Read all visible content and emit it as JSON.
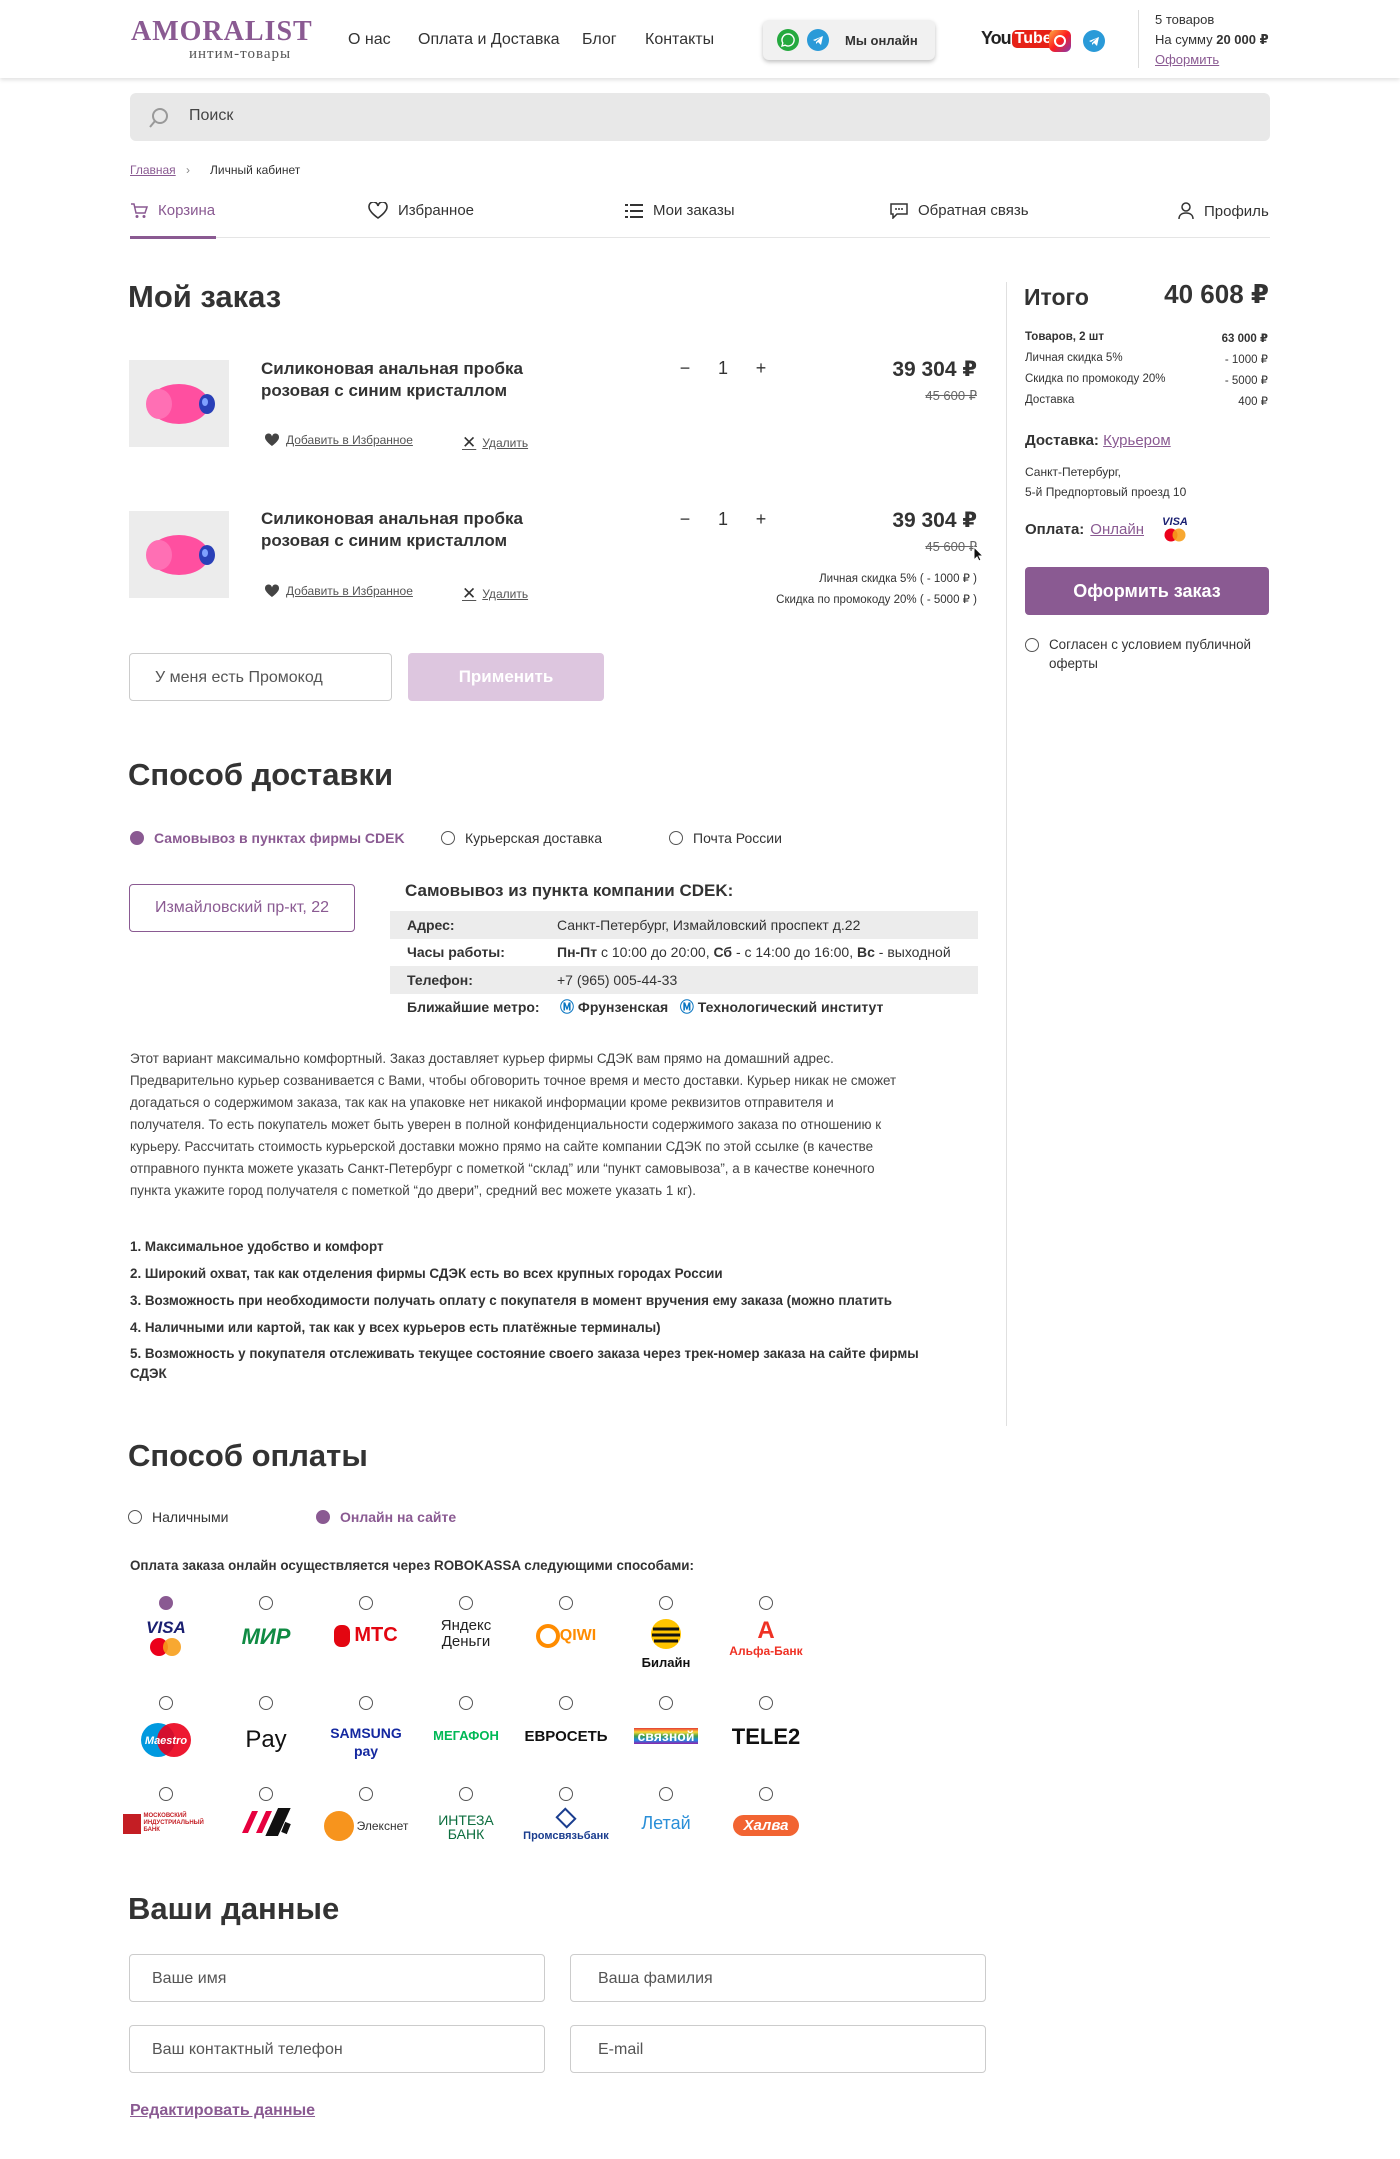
{
  "header": {
    "logo_name": "AMORALIST",
    "logo_sub": "интим-товары",
    "nav": [
      "О нас",
      "Оплата и Доставка",
      "Блог",
      "Контакты"
    ],
    "online_label": "Мы онлайн",
    "cart_count": "5 товаров",
    "cart_sum_label": "На сумму",
    "cart_sum": "20 000 ₽",
    "checkout_link": "Оформить"
  },
  "search": {
    "placeholder": "Поиск"
  },
  "breadcrumb": {
    "home": "Главная",
    "current": "Личный кабинет"
  },
  "tabs": [
    "Корзина",
    "Избранное",
    "Мои заказы",
    "Обратная связь",
    "Профиль"
  ],
  "order": {
    "title": "Мой заказ",
    "items": [
      {
        "title_l1": "Силиконовая анальная пробка",
        "title_l2": "розовая с синим кристаллом",
        "qty": "1",
        "price": "39 304 ₽",
        "old_price": "45 600 ₽",
        "fav": "Добавить в Избранное",
        "remove": "Удалить"
      },
      {
        "title_l1": "Силиконовая анальная пробка",
        "title_l2": "розовая с синим кристаллом",
        "qty": "1",
        "price": "39 304 ₽",
        "old_price": "45 600 ₽",
        "fav": "Добавить в Избранное",
        "remove": "Удалить",
        "discount1": "Личная скидка 5%  ( - 1000 ₽ )",
        "discount2": "Скидка по промокоду 20%  ( - 5000 ₽ )"
      }
    ],
    "minus": "−",
    "plus": "+"
  },
  "promo": {
    "placeholder": "У меня есть Промокод",
    "apply": "Применить"
  },
  "delivery": {
    "title": "Способ доставки",
    "options": [
      "Самовывоз в пунктах фирмы CDEK",
      "Курьерская доставка",
      "Почта России"
    ],
    "pickup_button": "Измайловский пр-кт, 22",
    "pickup_title": "Самовывоз из пункта компании CDEK:",
    "address_label": "Адрес:",
    "address": "Санкт-Петербург, Измайловский проспект д.22",
    "hours_label": "Часы работы:",
    "hours_a": "Пн-Пт",
    "hours_b": " с 10:00 до 20:00, ",
    "hours_c": "Сб",
    "hours_d": " - с 14:00 до 16:00, ",
    "hours_e": "Вс",
    "hours_f": " - выходной",
    "phone_label": "Телефон:",
    "phone": "+7 (965) 005-44-33",
    "metro_label": "Ближайшие метро:",
    "metro1": "Фрунзенская",
    "metro2": "Технологический институт",
    "description": [
      "Этот вариант максимально комфортный. Заказ доставляет курьер фирмы СДЭК вам прямо на домашний адрес.",
      "Предварительно курьер созванивается с Вами, чтобы обговорить точное время и место доставки. Курьер никак не сможет",
      "догадаться о содержимом заказа, так как на упаковке нет никакой информации кроме реквизитов отправителя и",
      "получателя. То есть покупатель может быть уверен в полной конфиденциальности содержимого заказа по отношению к",
      "курьеру. Рассчитать стоимость курьерской доставки можно прямо на сайте компании СДЭК по этой ссылке (в качестве",
      "отправного пункта можете указать Санкт-Петербург с пометкой “склад” или “пункт самовывоза”, а в качестве конечного",
      "пункта укажите город получателя с пометкой “до двери”, средний вес можете указать 1 кг)."
    ],
    "benefits": [
      "1. Максимальное удобство и комфорт",
      "2. Широкий охват, так как отделения фирмы СДЭК есть во всех крупных городах России",
      "3. Возможность при необходимости получать оплату с покупателя в момент вручения ему заказа (можно платить",
      "4. Наличными или картой, так как у всех курьеров есть платёжные терминалы)",
      "5. Возможность у покупателя отслеживать текущее состояние своего заказа через трек-номер заказа на сайте фирмы",
      "СДЭК"
    ]
  },
  "summary": {
    "title": "Итого",
    "total": "40 608 ₽",
    "rows": [
      {
        "label": "Товаров, 2 шт",
        "value": "63 000 ₽"
      },
      {
        "label": "Личная скидка 5%",
        "value": "- 1000 ₽"
      },
      {
        "label": "Скидка по промокоду 20%",
        "value": "- 5000 ₽"
      },
      {
        "label": "Доставка",
        "value": "400 ₽"
      }
    ],
    "delivery_label": "Доставка:",
    "delivery_value": "Курьером",
    "address_l1": "Санкт-Петербург,",
    "address_l2": "5-й Предпортовый проезд 10",
    "payment_label": "Оплата:",
    "payment_value": "Онлайн",
    "order_button": "Оформить заказ",
    "agree_l1": "Согласен с условием публичной",
    "agree_l2": "оферты"
  },
  "payment": {
    "title": "Способ оплаты",
    "options": [
      "Наличными",
      "Онлайн на сайте"
    ],
    "note": "Оплата заказа онлайн осуществляется через ROBOKASSA следующими способами:",
    "methods": [
      "VISA",
      "МИР",
      "МТС",
      "Яндекс Деньги",
      "QIWI",
      "Билайн",
      "Альфа-Банк",
      "Maestro",
      "Pay",
      "SAMSUNG pay",
      "МЕГАФОН",
      "ЕВРОСЕТЬ",
      "связной",
      "TELE2",
      "МОСКОВСКИЙ ИНДУСТРИАЛЬНЫЙ БАНК",
      "ИИ",
      "Элекснет",
      "ИНТЕЗА БАНК",
      "Промсвязьбанк",
      "Летай",
      "Халва"
    ]
  },
  "user": {
    "title": "Ваши данные",
    "first_name": "Ваше имя",
    "last_name": "Ваша фамилия",
    "phone": "Ваш контактный телефон",
    "email": "E-mail",
    "edit": "Редактировать данные"
  },
  "colors": {
    "accent": "#8a5a92",
    "accent_light": "#ddc6df",
    "search_bg": "#e8e8e8"
  }
}
